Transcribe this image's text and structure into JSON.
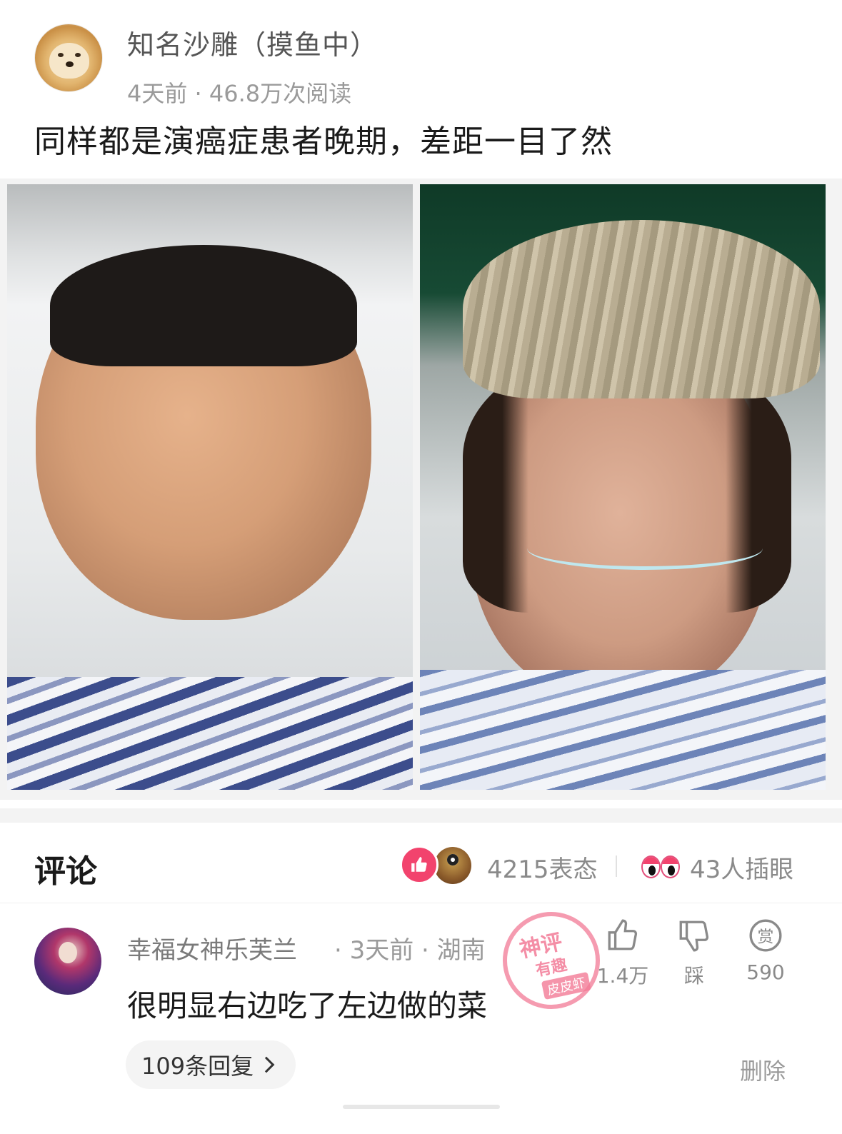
{
  "post": {
    "author": "知名沙雕（摸鱼中）",
    "meta": "4天前 · 46.8万次阅读",
    "title": "同样都是演癌症患者晚期，差距一目了然"
  },
  "comments_header": {
    "title": "评论",
    "reactions_count": "4215表态",
    "peek_count": "43人插眼"
  },
  "comment": {
    "author": "幸福女神乐芙兰",
    "meta": "· 3天前 · 湖南",
    "text": "很明显右边吃了左边做的菜",
    "stamp": {
      "line1": "神评",
      "line2": "有趣",
      "line3": "皮皮虾"
    },
    "like_count": "1.4万",
    "dislike_label": "踩",
    "reward_count": "590",
    "replies": "109条回复",
    "delete": "删除"
  },
  "colors": {
    "accent": "#f2436d",
    "muted": "#9a9a9a"
  },
  "icons": [
    "like-icon",
    "dislike-icon",
    "reward-icon",
    "chevron-right-icon",
    "eyes-icon"
  ]
}
